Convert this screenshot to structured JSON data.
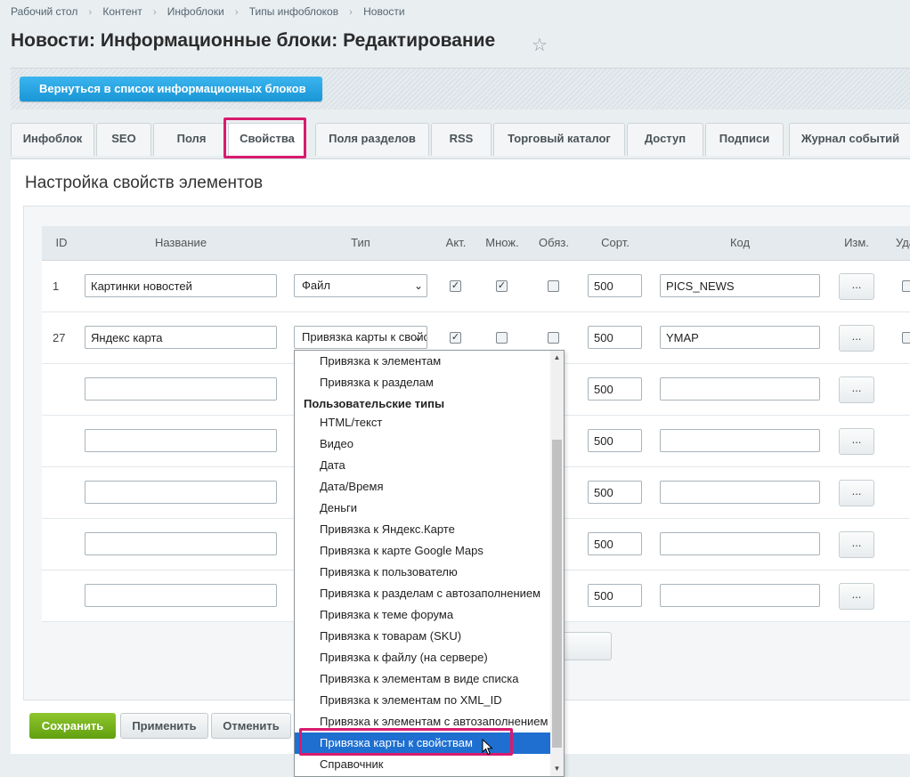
{
  "breadcrumb": [
    "Рабочий стол",
    "Контент",
    "Инфоблоки",
    "Типы инфоблоков",
    "Новости"
  ],
  "page_title": "Новости: Информационные блоки: Редактирование",
  "toolbar": {
    "back_label": "Вернуться в список информационных блоков"
  },
  "tabs": [
    "Инфоблок",
    "SEO",
    "Поля",
    "Свойства",
    "Поля разделов",
    "RSS",
    "Торговый каталог",
    "Доступ",
    "Подписи",
    "Журнал событий"
  ],
  "active_tab": "Свойства",
  "section_title": "Настройка свойств элементов",
  "columns": [
    "ID",
    "Название",
    "Тип",
    "Акт.",
    "Множ.",
    "Обяз.",
    "Сорт.",
    "Код",
    "Изм.",
    "Уда"
  ],
  "rows": [
    {
      "id": "1",
      "name": "Картинки новостей",
      "type": "Файл",
      "active": true,
      "multiple": true,
      "required": false,
      "sort": "500",
      "code": "PICS_NEWS",
      "edit": "..."
    },
    {
      "id": "27",
      "name": "Яндекс карта",
      "type": "Привязка карты к свойствам",
      "active": true,
      "multiple": false,
      "required": false,
      "sort": "500",
      "code": "YMAP",
      "edit": "..."
    },
    {
      "id": "",
      "name": "",
      "sort": "500",
      "code": "",
      "edit": "..."
    },
    {
      "id": "",
      "name": "",
      "sort": "500",
      "code": "",
      "edit": "..."
    },
    {
      "id": "",
      "name": "",
      "sort": "500",
      "code": "",
      "edit": "..."
    },
    {
      "id": "",
      "name": "",
      "sort": "500",
      "code": "",
      "edit": "..."
    },
    {
      "id": "",
      "name": "",
      "sort": "500",
      "code": "",
      "edit": "..."
    }
  ],
  "buttons": {
    "save": "Сохранить",
    "apply": "Применить",
    "cancel": "Отменить"
  },
  "dropdown": {
    "items_before": [
      "Привязка к элементам",
      "Привязка к разделам"
    ],
    "group_label": "Пользовательские типы",
    "items": [
      "HTML/текст",
      "Видео",
      "Дата",
      "Дата/Время",
      "Деньги",
      "Привязка к Яндекс.Карте",
      "Привязка к карте Google Maps",
      "Привязка к пользователю",
      "Привязка к разделам с автозаполнением",
      "Привязка к теме форума",
      "Привязка к товарам (SKU)",
      "Привязка к файлу (на сервере)",
      "Привязка к элементам в виде списка",
      "Привязка к элементам по XML_ID",
      "Привязка к элементам с автозаполнением",
      "Привязка карты к свойствам",
      "Справочник"
    ],
    "selected": "Привязка карты к свойствам"
  },
  "colors": {
    "accent_blue": "#1a96d6",
    "save_green": "#62a00f",
    "highlight_pink": "#d81b6e",
    "selected_blue": "#1e6fd0"
  }
}
